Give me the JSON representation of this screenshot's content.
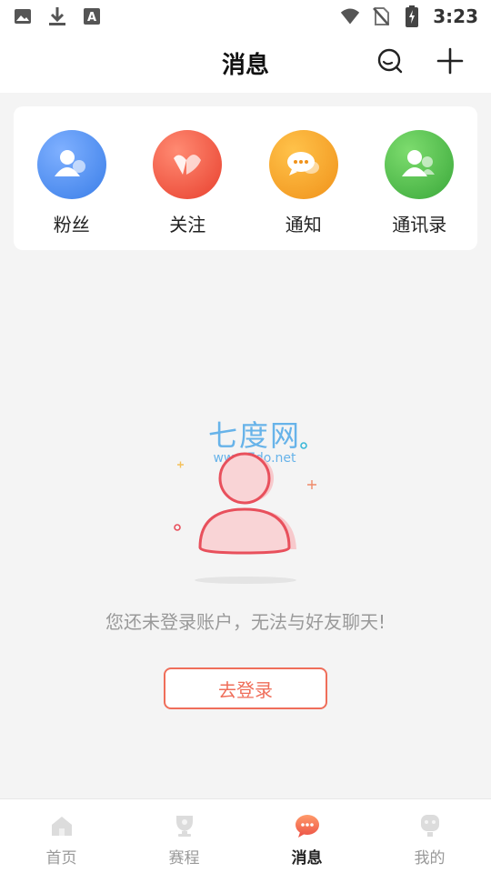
{
  "status_bar": {
    "time": "3:23",
    "left_icons": [
      "image-icon",
      "download-icon",
      "text-a-icon"
    ],
    "right_icons": [
      "wifi-icon",
      "no-sim-icon",
      "battery-charging-icon"
    ]
  },
  "header": {
    "title": "消息",
    "search_icon": "search-icon",
    "add_icon": "plus-icon"
  },
  "quick_items": [
    {
      "label": "粉丝",
      "icon": "fans-icon",
      "color": "#4a8ef0"
    },
    {
      "label": "关注",
      "icon": "heart-icon",
      "color": "#ef5a48"
    },
    {
      "label": "通知",
      "icon": "chat-bubble-icon",
      "color": "#f4a21b"
    },
    {
      "label": "通讯录",
      "icon": "contacts-icon",
      "color": "#4fbf4a"
    }
  ],
  "watermark": {
    "cn": "七度网",
    "url": "www.7do.net"
  },
  "empty_state": {
    "message": "您还未登录账户，无法与好友聊天!",
    "login_button": "去登录",
    "accent": "#ef6e5a"
  },
  "bottom_nav": [
    {
      "label": "首页",
      "icon": "home-icon",
      "active": false
    },
    {
      "label": "赛程",
      "icon": "trophy-icon",
      "active": false
    },
    {
      "label": "消息",
      "icon": "message-icon",
      "active": true
    },
    {
      "label": "我的",
      "icon": "profile-icon",
      "active": false
    }
  ]
}
